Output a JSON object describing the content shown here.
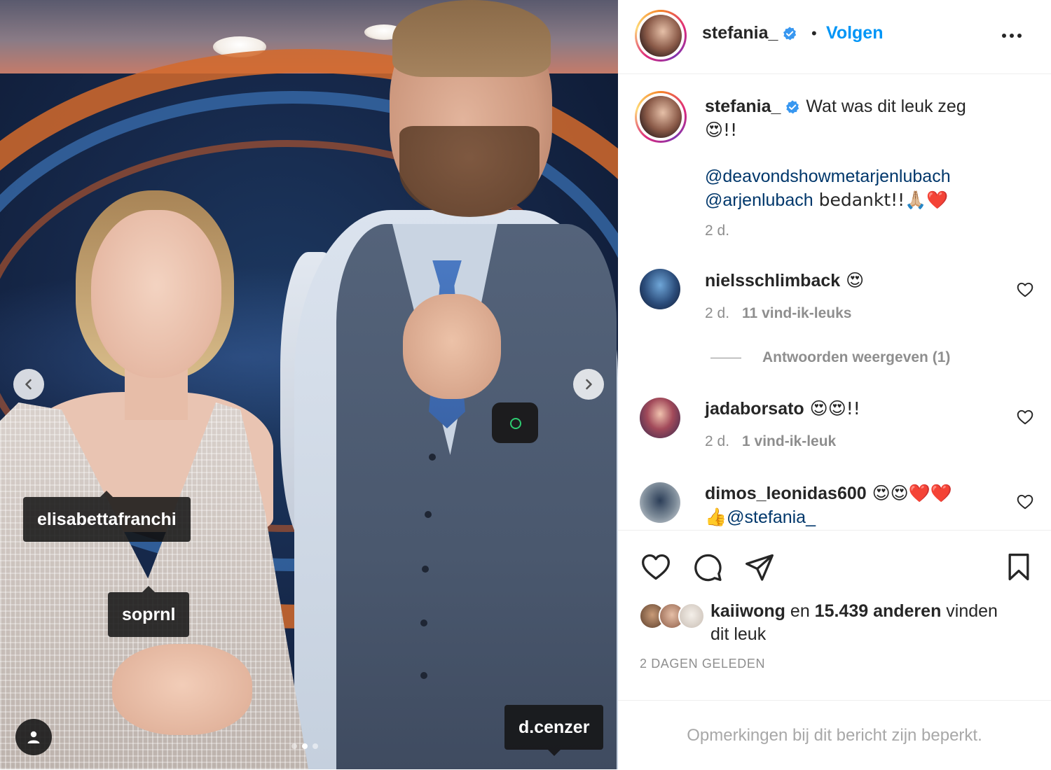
{
  "photo": {
    "tags": [
      "elisabettafranchi",
      "soprnl",
      "d.cenzer"
    ],
    "carousel": {
      "count": 3,
      "active_index": 1
    }
  },
  "header": {
    "username": "stefania_",
    "separator": "•",
    "follow_label": "Volgen"
  },
  "caption": {
    "username": "stefania_",
    "text": "Wat was dit leuk zeg",
    "emoji_line": "😍!!",
    "mention_1": "@deavondshowmetarjenlubach",
    "mention_2": "@arjenlubach",
    "after_mentions": " bedankt!!🙏🏼❤️",
    "time": "2 d."
  },
  "comments": [
    {
      "username": "nielsschlimback",
      "text": " 😍",
      "time": "2 d.",
      "likes": "11 vind-ik-leuks"
    },
    {
      "username": "jadaborsato",
      "text": " 😍😍!!",
      "time": "2 d.",
      "likes": "1 vind-ik-leuk"
    },
    {
      "username": "dimos_leonidas600",
      "text": " 😍😍❤️❤️",
      "text_line2": "👍",
      "mention": "@stefania_"
    }
  ],
  "replies_label": "Antwoorden weergeven (1)",
  "likes": {
    "user": "kaiiwong",
    "connector": " en ",
    "others": "15.439 anderen",
    "suffix": " vinden dit leuk"
  },
  "timestamp": "2 DAGEN GELEDEN",
  "restricted_notice": "Opmerkingen bij dit bericht zijn beperkt.",
  "colors": {
    "accent": "#0095f6",
    "mention": "#00376b",
    "muted": "#8e8e8e",
    "verified": "#3897f0"
  },
  "icons": [
    "verified-badge-icon",
    "more-options-icon",
    "heart-icon",
    "comment-icon",
    "share-icon",
    "bookmark-icon",
    "chevron-left-icon",
    "chevron-right-icon",
    "user-tag-icon"
  ]
}
